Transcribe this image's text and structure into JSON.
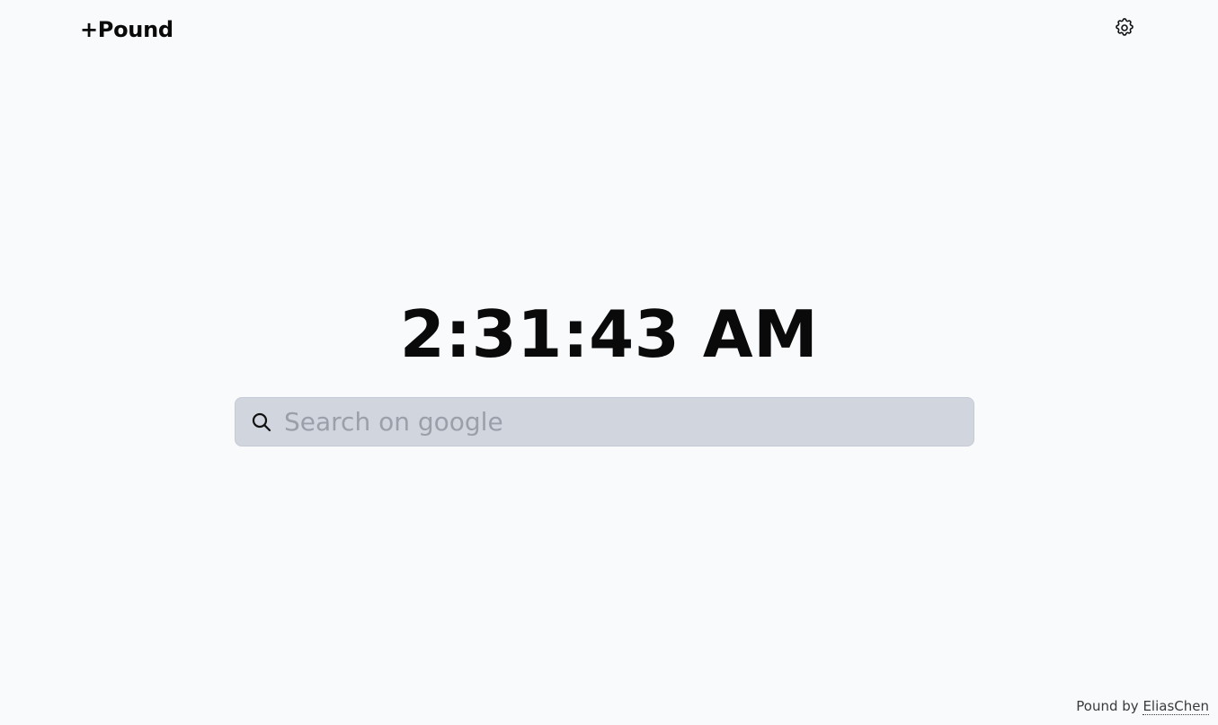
{
  "header": {
    "brand": "+Pound",
    "settings_icon": "gear-icon"
  },
  "clock": {
    "time": "2:31:43 AM"
  },
  "search": {
    "icon": "search-icon",
    "placeholder": "Search on google",
    "value": ""
  },
  "footer": {
    "prefix": "Pound by ",
    "author": "EliasChen"
  }
}
